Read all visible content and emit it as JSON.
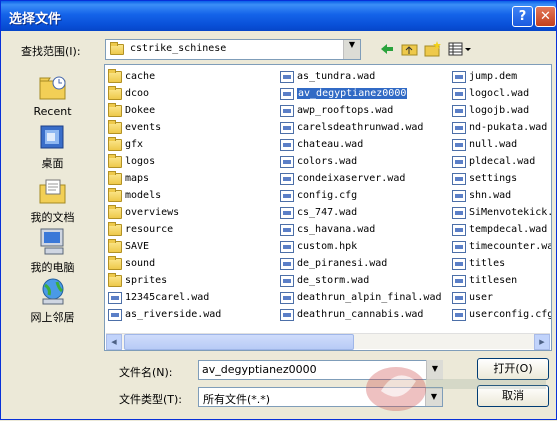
{
  "window": {
    "title": "选择文件",
    "help_glyph": "?",
    "close_glyph": "✕"
  },
  "lookin": {
    "label": "查找范围(I):",
    "value": "cstrike_schinese"
  },
  "toolbar": {
    "back_icon": "back-arrow-icon",
    "up_icon": "up-folder-icon",
    "new_icon": "new-folder-icon",
    "view_icon": "view-menu-icon"
  },
  "places": [
    {
      "label": "Recent"
    },
    {
      "label": "桌面"
    },
    {
      "label": "我的文档"
    },
    {
      "label": "我的电脑"
    },
    {
      "label": "网上邻居"
    }
  ],
  "files": {
    "col1": [
      {
        "name": "cache",
        "type": "folder"
      },
      {
        "name": "dcoo",
        "type": "folder"
      },
      {
        "name": "Dokee",
        "type": "folder"
      },
      {
        "name": "events",
        "type": "folder"
      },
      {
        "name": "gfx",
        "type": "folder"
      },
      {
        "name": "logos",
        "type": "folder"
      },
      {
        "name": "maps",
        "type": "folder"
      },
      {
        "name": "models",
        "type": "folder"
      },
      {
        "name": "overviews",
        "type": "folder"
      },
      {
        "name": "resource",
        "type": "folder"
      },
      {
        "name": "SAVE",
        "type": "folder"
      },
      {
        "name": "sound",
        "type": "folder"
      },
      {
        "name": "sprites",
        "type": "folder"
      },
      {
        "name": "12345carel.wad",
        "type": "file"
      },
      {
        "name": "as_riverside.wad",
        "type": "file"
      }
    ],
    "col2": [
      {
        "name": "as_tundra.wad",
        "type": "file"
      },
      {
        "name": "av_degyptianez0000",
        "type": "file",
        "selected": true
      },
      {
        "name": "awp_rooftops.wad",
        "type": "file"
      },
      {
        "name": "carelsdeathrunwad.wad",
        "type": "file"
      },
      {
        "name": "chateau.wad",
        "type": "file"
      },
      {
        "name": "colors.wad",
        "type": "file"
      },
      {
        "name": "condeixaserver.wad",
        "type": "file"
      },
      {
        "name": "config.cfg",
        "type": "file"
      },
      {
        "name": "cs_747.wad",
        "type": "file"
      },
      {
        "name": "cs_havana.wad",
        "type": "file"
      },
      {
        "name": "custom.hpk",
        "type": "file"
      },
      {
        "name": "de_piranesi.wad",
        "type": "file"
      },
      {
        "name": "de_storm.wad",
        "type": "file"
      },
      {
        "name": "deathrun_alpin_final.wad",
        "type": "file"
      },
      {
        "name": "deathrun_cannabis.wad",
        "type": "file"
      }
    ],
    "col3": [
      {
        "name": "jump.dem",
        "type": "file"
      },
      {
        "name": "logocl.wad",
        "type": "file"
      },
      {
        "name": "logojb.wad",
        "type": "file"
      },
      {
        "name": "nd-pukata.wad",
        "type": "file"
      },
      {
        "name": "null.wad",
        "type": "file"
      },
      {
        "name": "pldecal.wad",
        "type": "file"
      },
      {
        "name": "settings",
        "type": "file"
      },
      {
        "name": "shn.wad",
        "type": "file"
      },
      {
        "name": "SiMenvotekick.",
        "type": "file"
      },
      {
        "name": "tempdecal.wad",
        "type": "file"
      },
      {
        "name": "timecounter.wa",
        "type": "file"
      },
      {
        "name": "titles",
        "type": "file"
      },
      {
        "name": "titlesen",
        "type": "file"
      },
      {
        "name": "user",
        "type": "file"
      },
      {
        "name": "userconfig.cfg",
        "type": "file"
      }
    ]
  },
  "filename": {
    "label": "文件名(N):",
    "value": "av_degyptianez0000"
  },
  "filetype": {
    "label": "文件类型(T):",
    "value": "所有文件(*.*)"
  },
  "buttons": {
    "open": "打开(O)",
    "cancel": "取消"
  }
}
